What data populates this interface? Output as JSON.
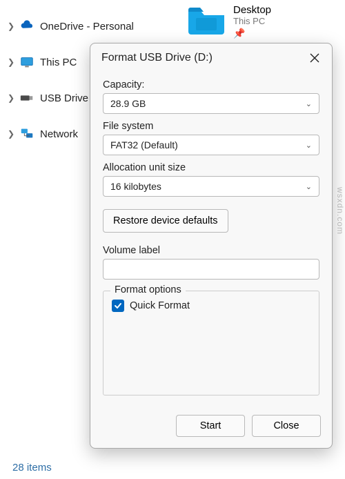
{
  "sidebar": {
    "items": [
      {
        "label": "OneDrive - Personal",
        "icon": "onedrive"
      },
      {
        "label": "This PC",
        "icon": "thispc"
      },
      {
        "label": "USB Drive",
        "icon": "usb"
      },
      {
        "label": "Network",
        "icon": "network"
      }
    ]
  },
  "content": {
    "desktop": {
      "title": "Desktop",
      "subtitle": "This PC"
    }
  },
  "dialog": {
    "title": "Format USB Drive (D:)",
    "capacity": {
      "label": "Capacity:",
      "value": "28.9 GB"
    },
    "filesystem": {
      "label": "File system",
      "value": "FAT32 (Default)"
    },
    "allocation": {
      "label": "Allocation unit size",
      "value": "16 kilobytes"
    },
    "restore_label": "Restore device defaults",
    "volume": {
      "label": "Volume label",
      "value": ""
    },
    "options": {
      "legend": "Format options",
      "quick_label": "Quick Format",
      "quick_checked": true
    },
    "start_label": "Start",
    "close_label": "Close"
  },
  "status": {
    "items_text": "28 items"
  },
  "watermark": "wsxdn.com"
}
